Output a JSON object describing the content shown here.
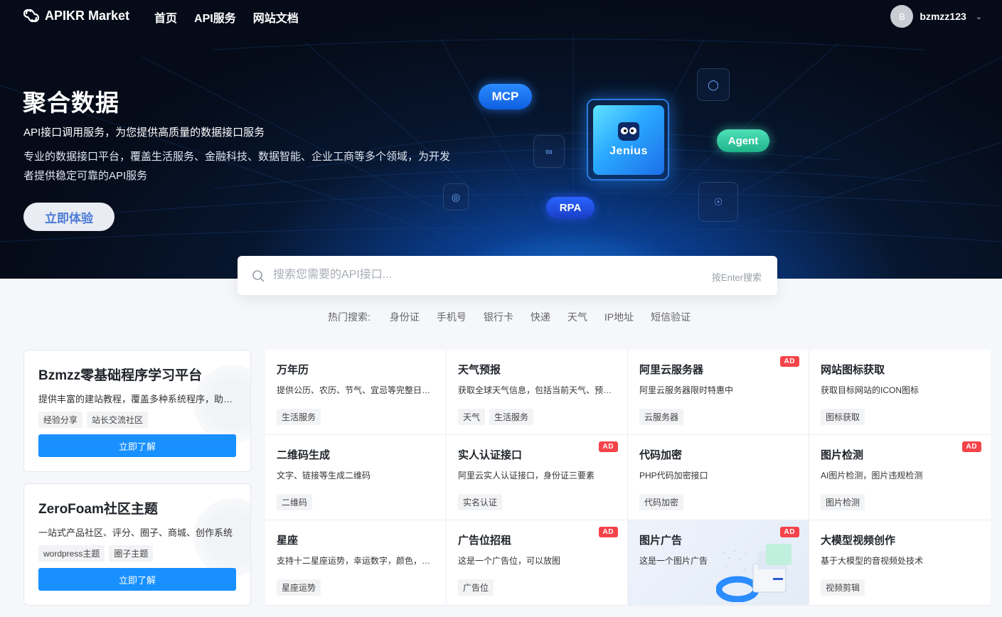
{
  "brand": {
    "name": "APIKR Market"
  },
  "nav": [
    "首页",
    "API服务",
    "网站文档"
  ],
  "user": {
    "initial": "B",
    "name": "bzmzz123"
  },
  "hero": {
    "title": "聚合数据",
    "subtitle": "API接口调用服务，为您提供高质量的数据接口服务",
    "description": "专业的数据接口平台，覆盖生活服务、金融科技、数据智能、企业工商等多个领域，为开发者提供稳定可靠的API服务",
    "cta": "立即体验",
    "badges": {
      "mcp": "MCP",
      "agent": "Agent",
      "rpa": "RPA",
      "core": "Jenius"
    }
  },
  "search": {
    "placeholder": "搜索您需要的API接口...",
    "hint": "按Enter搜索"
  },
  "hot_search": {
    "label": "热门搜索:",
    "items": [
      "身份证",
      "手机号",
      "银行卡",
      "快递",
      "天气",
      "IP地址",
      "短信验证"
    ]
  },
  "promos": [
    {
      "title": "Bzmzz零基础程序学习平台",
      "desc": "提供丰富的建站教程，覆盖多种系统程序，助力新手快速入门",
      "tags": [
        "经验分享",
        "站长交流社区"
      ],
      "button": "立即了解"
    },
    {
      "title": "ZeroFoam社区主题",
      "desc": "一站式产品社区、评分、圈子、商城、创作系统",
      "tags": [
        "wordpress主题",
        "圈子主题"
      ],
      "button": "立即了解"
    }
  ],
  "ad_label": "AD",
  "apis": [
    {
      "title": "万年历",
      "desc": "提供公历、农历、节气、宜忌等完整日历信息",
      "tags": [
        "生活服务"
      ],
      "ad": false
    },
    {
      "title": "天气预报",
      "desc": "获取全球天气信息，包括当前天气、预报等数据",
      "tags": [
        "天气",
        "生活服务"
      ],
      "ad": false
    },
    {
      "title": "阿里云服务器",
      "desc": "阿里云服务器限时特惠中",
      "tags": [
        "云服务器"
      ],
      "ad": true
    },
    {
      "title": "网站图标获取",
      "desc": "获取目标网站的ICON图标",
      "tags": [
        "图标获取"
      ],
      "ad": false
    },
    {
      "title": "二维码生成",
      "desc": "文字、链接等生成二维码",
      "tags": [
        "二维码"
      ],
      "ad": false
    },
    {
      "title": "实人认证接口",
      "desc": "阿里云实人认证接口，身份证三要素",
      "tags": [
        "实名认证"
      ],
      "ad": true
    },
    {
      "title": "代码加密",
      "desc": "PHP代码加密接口",
      "tags": [
        "代码加密"
      ],
      "ad": false
    },
    {
      "title": "图片检测",
      "desc": "AI图片检测，图片违规检测",
      "tags": [
        "图片检测"
      ],
      "ad": true
    },
    {
      "title": "星座",
      "desc": "支持十二星座运势，幸运数字，颜色，速配星座等",
      "tags": [
        "星座运势"
      ],
      "ad": false
    },
    {
      "title": "广告位招租",
      "desc": "这是一个广告位，可以放图",
      "tags": [
        "广告位"
      ],
      "ad": true
    },
    {
      "title": "图片广告",
      "desc": "这是一个图片广告",
      "tags": [],
      "ad": true,
      "image": true
    },
    {
      "title": "大模型视频创作",
      "desc": "基于大模型的音视频处技术",
      "tags": [
        "视频剪辑"
      ],
      "ad": false
    }
  ]
}
